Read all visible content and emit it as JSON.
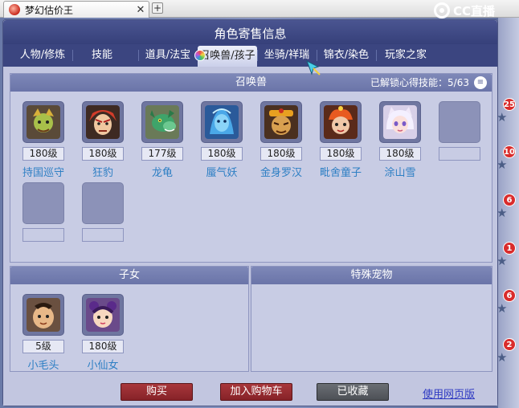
{
  "browser": {
    "tab_title": "梦幻估价王",
    "close_glyph": "✕",
    "new_tab_glyph": "+"
  },
  "window": {
    "title": "角色寄售信息",
    "brand": "CC直播"
  },
  "nav": {
    "tabs": [
      {
        "label": "人物/修炼",
        "active": false
      },
      {
        "label": "技能",
        "active": false
      },
      {
        "label": "道具/法宝",
        "active": false
      },
      {
        "label": "召唤兽/孩子",
        "active": true
      },
      {
        "label": "坐骑/祥瑞",
        "active": false
      },
      {
        "label": "锦衣/染色",
        "active": false
      },
      {
        "label": "玩家之家",
        "active": false
      }
    ]
  },
  "pets": {
    "header": "召唤兽",
    "unlock_label": "已解锁心得技能：",
    "unlock_value": "5/63",
    "menu_glyph": "≡",
    "items": [
      {
        "level": "180级",
        "name": "持国巡守",
        "icon": "green-warrior-avatar"
      },
      {
        "level": "180级",
        "name": "狂豹",
        "icon": "red-haired-warrior-avatar"
      },
      {
        "level": "177级",
        "name": "龙龟",
        "icon": "green-dragon-avatar"
      },
      {
        "level": "180级",
        "name": "蜃气妖",
        "icon": "blue-spirit-avatar"
      },
      {
        "level": "180级",
        "name": "金身罗汉",
        "icon": "golden-monk-avatar"
      },
      {
        "level": "180级",
        "name": "毗舍童子",
        "icon": "fire-child-avatar"
      },
      {
        "level": "180级",
        "name": "涂山雪",
        "icon": "fox-girl-avatar"
      }
    ]
  },
  "children": {
    "header": "子女",
    "items": [
      {
        "level": "5级",
        "name": "小毛头",
        "icon": "boy-avatar"
      },
      {
        "level": "180级",
        "name": "小仙女",
        "icon": "fairy-girl-avatar"
      }
    ]
  },
  "special_pets": {
    "header": "特殊宠物"
  },
  "actions": {
    "buy": "购买",
    "add_cart": "加入购物车",
    "favorited": "已收藏",
    "web_version": "使用网页版"
  },
  "side_badges": [
    "25",
    "10",
    "6",
    "1",
    "6",
    "2"
  ],
  "colors": {
    "titlebar": "#36407a",
    "accent_name": "#2e7fc4",
    "buy_button": "#862228",
    "favorited_button": "#4d5056"
  }
}
